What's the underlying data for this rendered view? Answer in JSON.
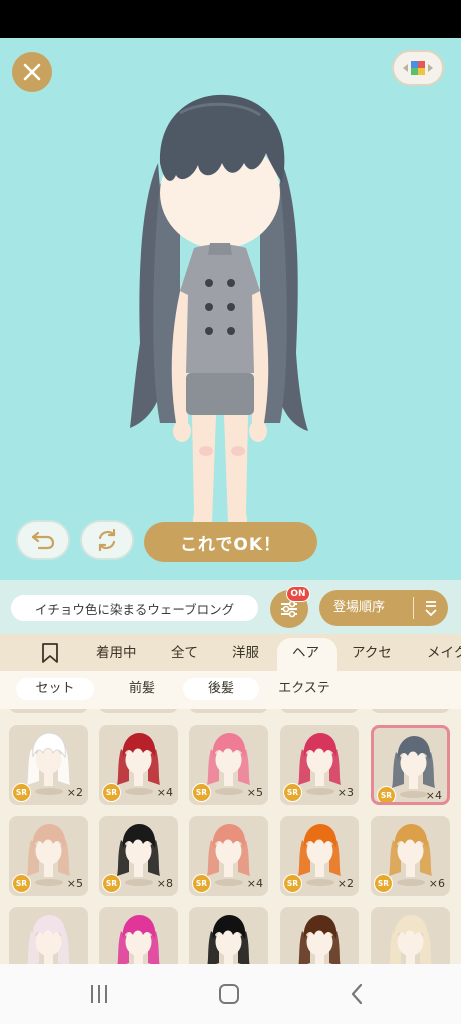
{
  "toolbar": {
    "ok_label": "これでOK！"
  },
  "filter": {
    "item_name": "イチョウ色に染まるウェーブロング",
    "filter_badge": "ON",
    "sort_label": "登場順序"
  },
  "tabs": [
    {
      "label": "着用中"
    },
    {
      "label": "全て"
    },
    {
      "label": "洋服"
    },
    {
      "label": "ヘア"
    },
    {
      "label": "アクセ"
    },
    {
      "label": "メイク"
    }
  ],
  "subtabs": [
    {
      "label": "セット"
    },
    {
      "label": "前髪"
    },
    {
      "label": "後髪"
    },
    {
      "label": "エクステ"
    }
  ],
  "items": [
    {
      "rarity": "SR",
      "count": "×2",
      "hair_color": "#ffffff"
    },
    {
      "rarity": "SR",
      "count": "×4",
      "hair_color": "#b8202a"
    },
    {
      "rarity": "SR",
      "count": "×5",
      "hair_color": "#f07b95"
    },
    {
      "rarity": "SR",
      "count": "×3",
      "hair_color": "#d7355c"
    },
    {
      "rarity": "SR",
      "count": "×4",
      "hair_color": "#5f6a78"
    },
    {
      "rarity": "SR",
      "count": "×5",
      "hair_color": "#e3b7a0"
    },
    {
      "rarity": "SR",
      "count": "×8",
      "hair_color": "#1a1a1a"
    },
    {
      "rarity": "SR",
      "count": "×4",
      "hair_color": "#e8917c"
    },
    {
      "rarity": "SR",
      "count": "×2",
      "hair_color": "#ea6f14"
    },
    {
      "rarity": "SR",
      "count": "×6",
      "hair_color": "#dca04a"
    },
    {
      "rarity": "",
      "count": "",
      "hair_color": "#f2e3ea"
    },
    {
      "rarity": "",
      "count": "",
      "hair_color": "#e0369a"
    },
    {
      "rarity": "",
      "count": "",
      "hair_color": "#111111"
    },
    {
      "rarity": "",
      "count": "",
      "hair_color": "#5a2d16"
    },
    {
      "rarity": "",
      "count": "",
      "hair_color": "#f2e4c8"
    }
  ],
  "colors": {
    "accent": "#c9a35d",
    "stage": "#a6e6e4",
    "selected_border": "#e58a94",
    "badge_red": "#e84b42"
  }
}
